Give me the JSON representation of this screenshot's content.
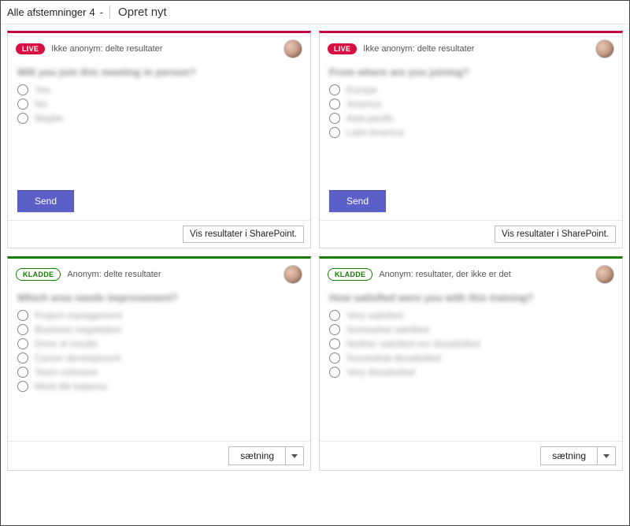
{
  "header": {
    "title_prefix": "Alle afstemninger",
    "count": "4",
    "create_new": "Opret nyt"
  },
  "badges": {
    "live": "LIVE",
    "draft": "KLADDE"
  },
  "buttons": {
    "send": "Send",
    "view_sp": "Vis resultater i SharePoint.",
    "sentence": "sætning"
  },
  "cards": [
    {
      "status": "live",
      "anon": "Ikke anonym: delte resultater",
      "question": "Will you join this meeting in person?",
      "options": [
        "Yes",
        "No",
        "Maybe"
      ]
    },
    {
      "status": "live",
      "anon": "Ikke anonym: delte resultater",
      "question": "From where are you joining?",
      "options": [
        "Europe",
        "America",
        "Asia pacific",
        "Latin America"
      ]
    },
    {
      "status": "draft",
      "anon": "Anonym: delte resultater",
      "question": "Which area needs improvement?",
      "options": [
        "Project management",
        "Business negotiation",
        "Drive of results",
        "Career development",
        "Team cohesion",
        "Work life balance"
      ]
    },
    {
      "status": "draft",
      "anon": "Anonym: resultater, der ikke er det",
      "question": "How satisfied were you with this training?",
      "options": [
        "Very satisfied",
        "Somewhat satisfied",
        "Neither satisfied nor dissatisfied",
        "Somewhat dissatisfied",
        "Very dissatisfied"
      ]
    }
  ]
}
